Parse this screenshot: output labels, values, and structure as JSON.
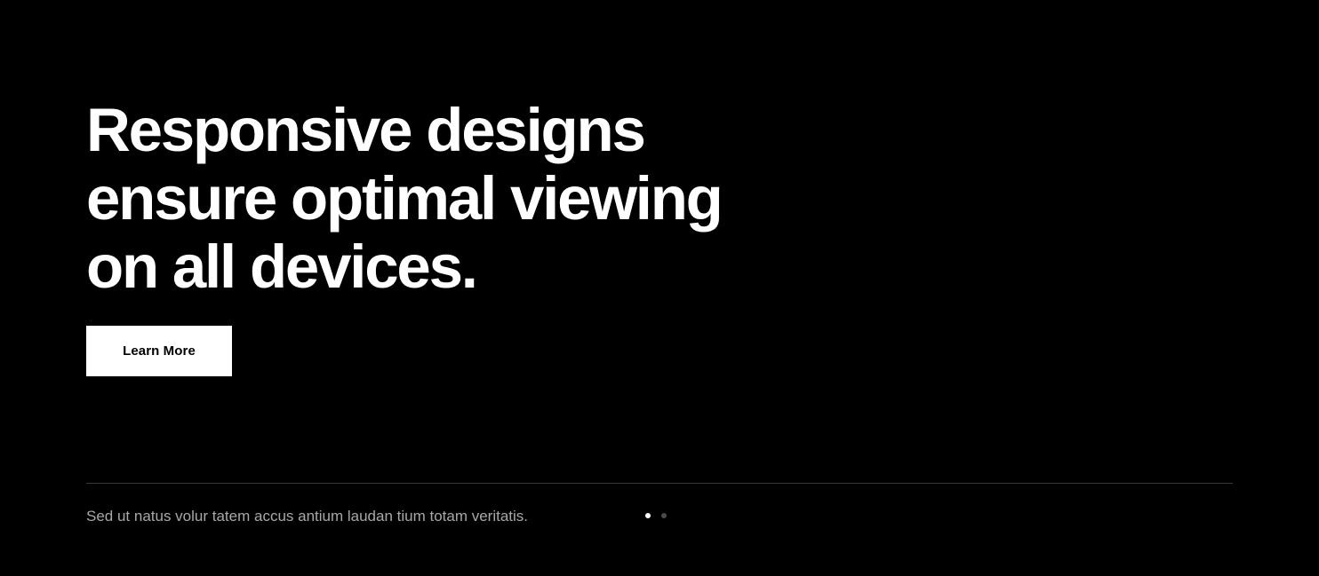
{
  "hero": {
    "title_lines": [
      "Responsive designs",
      "ensure optimal viewing",
      "on all devices."
    ],
    "cta_label": "Learn More"
  },
  "footer": {
    "tagline": "Sed ut natus volur tatem accus antium laudan tium totam veritatis."
  },
  "slider": {
    "total_slides": 2,
    "active_index": 0
  },
  "colors": {
    "background": "#000000",
    "text_primary": "#ffffff",
    "text_muted": "#a8a8a8",
    "divider": "#3a3a3a",
    "dot_active": "#ffffff",
    "dot_inactive": "#4a4a4a"
  }
}
